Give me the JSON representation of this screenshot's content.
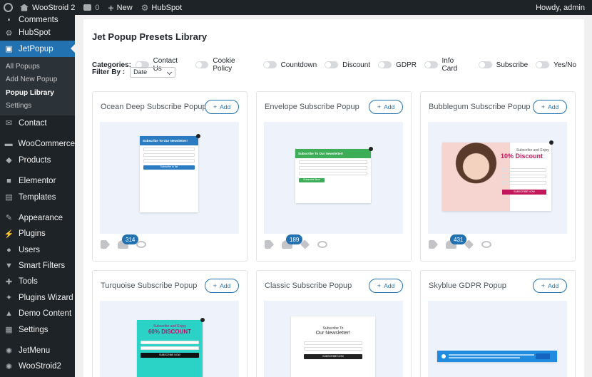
{
  "adminbar": {
    "site_name": "WooStroid 2",
    "comments": "0",
    "new": "New",
    "hubspot": "HubSpot",
    "greeting": "Howdy, admin"
  },
  "sidebar": {
    "items": [
      {
        "label": "Comments",
        "icon": "comment-icon"
      },
      {
        "label": "HubSpot",
        "icon": "hubspot-icon"
      },
      {
        "label": "JetPopup",
        "icon": "jetpopup-icon"
      },
      {
        "label": "Contact",
        "icon": "mail-icon"
      },
      {
        "label": "WooCommerce",
        "icon": "woocommerce-icon"
      },
      {
        "label": "Products",
        "icon": "box-icon"
      },
      {
        "label": "Elementor",
        "icon": "elementor-icon"
      },
      {
        "label": "Templates",
        "icon": "folder-icon"
      },
      {
        "label": "Appearance",
        "icon": "brush-icon"
      },
      {
        "label": "Plugins",
        "icon": "plug-icon"
      },
      {
        "label": "Users",
        "icon": "user-icon"
      },
      {
        "label": "Smart Filters",
        "icon": "filter-icon"
      },
      {
        "label": "Tools",
        "icon": "wrench-icon"
      },
      {
        "label": "Plugins Wizard",
        "icon": "wizard-icon"
      },
      {
        "label": "Demo Content",
        "icon": "import-icon"
      },
      {
        "label": "Settings",
        "icon": "settings-icon"
      },
      {
        "label": "JetMenu",
        "icon": "gear-icon"
      },
      {
        "label": "WooStroid2",
        "icon": "gear-icon"
      }
    ],
    "submenu": [
      "All Popups",
      "Add New Popup",
      "Popup Library",
      "Settings"
    ]
  },
  "library": {
    "title": "Jet Popup Presets Library",
    "categories_label": "Categories:",
    "categories": [
      "Contact Us",
      "Cookie Policy",
      "Countdown",
      "Discount",
      "GDPR",
      "Info Card",
      "Subscribe",
      "Yes/No"
    ],
    "filter_label": "Filter By :",
    "filter_value": "Date",
    "add_label": "Add"
  },
  "cards": [
    {
      "title": "Ocean Deep Subscribe Popup",
      "count": "314"
    },
    {
      "title": "Envelope Subscribe Popup",
      "count": "189"
    },
    {
      "title": "Bubblegum Subscribe Popup",
      "count": "431"
    },
    {
      "title": "Turquoise Subscribe Popup"
    },
    {
      "title": "Classic Subscribe Popup"
    },
    {
      "title": "Skyblue GDPR Popup"
    }
  ],
  "previews": {
    "ocean": {
      "heading": "Subscribe To Our Newsletter!",
      "button": "Subscribe to list"
    },
    "envelope": {
      "heading": "Subscribe To Our Newsletter!",
      "button": "Subscribe Now"
    },
    "bubble": {
      "line1": "Subscribe and Enjoy",
      "line2": "10% Discount",
      "button": "SUBSCRIBE NOW"
    },
    "turquoise": {
      "line1": "Subscribe and Enjoy",
      "line2": "60% DISCOUNT",
      "button": "SUBSCRIBE NOW"
    },
    "classic": {
      "line1": "Subscribe To",
      "line2": "Our Newsletter!",
      "button": "SUBSCRIBE NOW"
    }
  },
  "colors": {
    "accent": "#2271b1",
    "sidebar": "#1d2327"
  }
}
